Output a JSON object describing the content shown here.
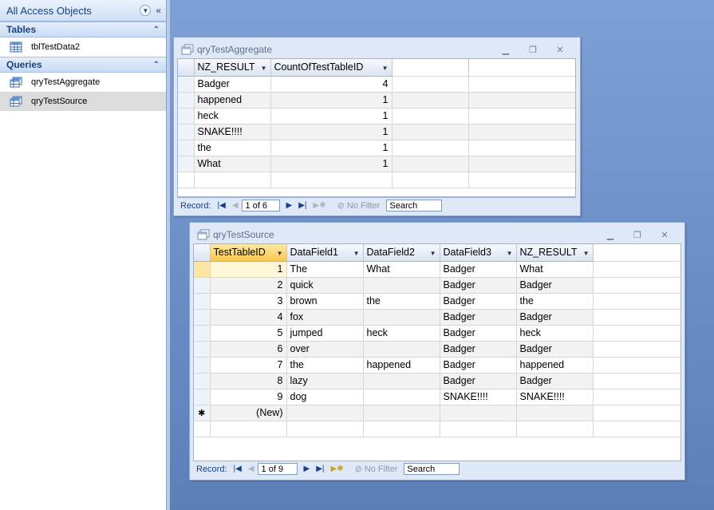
{
  "nav": {
    "header": "All Access Objects",
    "groups": [
      {
        "label": "Tables",
        "items": [
          "tblTestData2"
        ]
      },
      {
        "label": "Queries",
        "items": [
          "qryTestAggregate",
          "qryTestSource"
        ]
      }
    ],
    "selected": "qryTestSource"
  },
  "aggregate": {
    "title": "qryTestAggregate",
    "columns": [
      "NZ_RESULT",
      "CountOfTestTableID"
    ],
    "rows": [
      [
        "Badger",
        "4"
      ],
      [
        "happened",
        "1"
      ],
      [
        "heck",
        "1"
      ],
      [
        "SNAKE!!!!",
        "1"
      ],
      [
        "the",
        "1"
      ],
      [
        "What",
        "1"
      ]
    ],
    "record_label": "Record:",
    "record_pos": "1 of 6",
    "filter_label": "No Filter",
    "search_label": "Search"
  },
  "source": {
    "title": "qryTestSource",
    "columns": [
      "TestTableID",
      "DataField1",
      "DataField2",
      "DataField3",
      "NZ_RESULT"
    ],
    "rows": [
      [
        "1",
        "The",
        "What",
        "Badger",
        "What"
      ],
      [
        "2",
        "quick",
        "",
        "Badger",
        "Badger"
      ],
      [
        "3",
        "brown",
        "the",
        "Badger",
        "the"
      ],
      [
        "4",
        "fox",
        "",
        "Badger",
        "Badger"
      ],
      [
        "5",
        "jumped",
        "heck",
        "Badger",
        "heck"
      ],
      [
        "6",
        "over",
        "",
        "Badger",
        "Badger"
      ],
      [
        "7",
        "the",
        "happened",
        "Badger",
        "happened"
      ],
      [
        "8",
        "lazy",
        "",
        "Badger",
        "Badger"
      ],
      [
        "9",
        "dog",
        "",
        "SNAKE!!!!",
        "SNAKE!!!!"
      ]
    ],
    "new_row_label": "(New)",
    "new_row_marker": "✱",
    "record_label": "Record:",
    "record_pos": "1 of 9",
    "filter_label": "No Filter",
    "search_label": "Search"
  },
  "window_controls": {
    "minimize": "▁",
    "restore": "❐",
    "close": "✕"
  },
  "colors": {
    "accent": "#15428b",
    "selected_header": "#f7c84e",
    "workspace": "#6f8ec4"
  }
}
